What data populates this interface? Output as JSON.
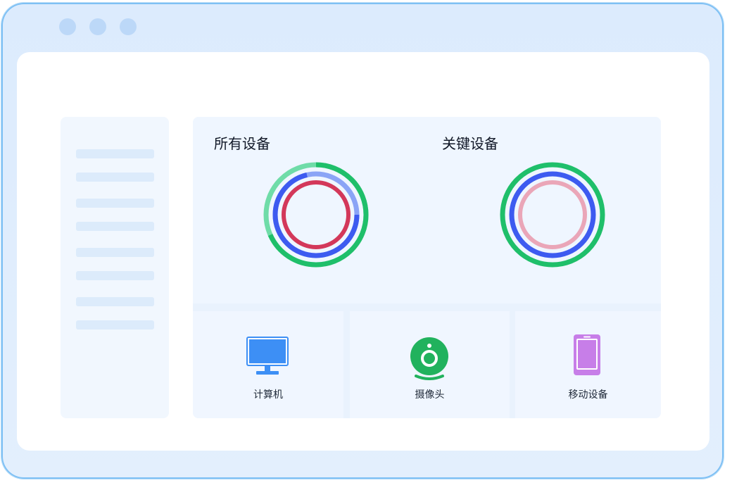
{
  "window": {
    "controls": [
      "window-dot-1",
      "window-dot-2",
      "window-dot-3"
    ]
  },
  "sidebar": {
    "items": [
      "",
      "",
      "",
      "",
      "",
      "",
      "",
      ""
    ]
  },
  "panels": {
    "all_devices": {
      "title": "所有设备"
    },
    "key_devices": {
      "title": "关键设备"
    }
  },
  "device_cards": [
    {
      "label": "计算机",
      "icon": "monitor-icon"
    },
    {
      "label": "摄像头",
      "icon": "webcam-icon"
    },
    {
      "label": "移动设备",
      "icon": "mobile-phone-icon"
    }
  ],
  "colors": {
    "green": "#1fbf6a",
    "light_green": "#6fdca8",
    "blue": "#3d5bf0",
    "light_blue": "#8aa4f6",
    "red": "#d3385a",
    "pink": "#eaa6b8",
    "monitor_blue": "#3d8ff5",
    "webcam_green": "#21b25d",
    "phone_purple": "#c77ee8"
  }
}
